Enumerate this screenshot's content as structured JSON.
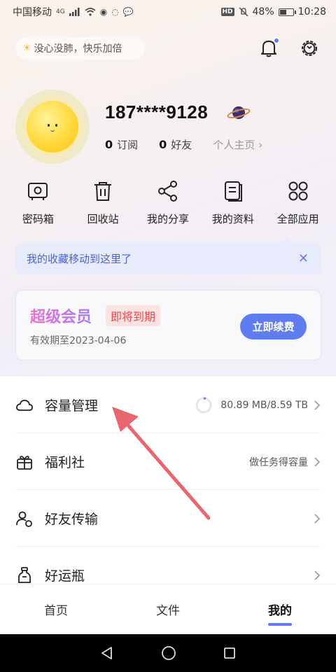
{
  "status_bar": {
    "carrier": "中国移动",
    "network": "4G",
    "battery": "48%",
    "time": "10:28",
    "hd": "HD"
  },
  "header": {
    "mood": "没心没肺，快乐加倍",
    "mood_icon": "☀"
  },
  "profile": {
    "phone": "187****9128",
    "subscribe_count": "0",
    "subscribe_label": "订阅",
    "friends_count": "0",
    "friends_label": "好友",
    "homepage_label": "个人主页 ›"
  },
  "grid": {
    "items": [
      {
        "label": "密码箱",
        "icon": "safe-icon"
      },
      {
        "label": "回收站",
        "icon": "trash-icon"
      },
      {
        "label": "我的分享",
        "icon": "share-icon"
      },
      {
        "label": "我的资料",
        "icon": "document-icon"
      },
      {
        "label": "全部应用",
        "icon": "apps-icon"
      }
    ]
  },
  "tip": {
    "text": "我的收藏移动到这里了",
    "close": "✕"
  },
  "vip": {
    "title": "超级会员",
    "tag": "即将到期",
    "expiry": "有效期至2023-04-06",
    "renew_label": "立即续费"
  },
  "list": {
    "items": [
      {
        "label": "容量管理",
        "value": "80.89 MB/8.59 TB",
        "icon": "cloud-icon"
      },
      {
        "label": "福利社",
        "value": "做任务得容量",
        "icon": "gift-icon"
      },
      {
        "label": "好友传输",
        "value": "",
        "icon": "friend-transfer-icon"
      },
      {
        "label": "好运瓶",
        "value": "",
        "icon": "bottle-icon"
      }
    ]
  },
  "tabs": [
    {
      "label": "首页"
    },
    {
      "label": "文件"
    },
    {
      "label": "我的",
      "active": true
    }
  ],
  "colors": {
    "accent": "#5f7df1",
    "tag_red": "#e7474a",
    "arrow": "#e8666e"
  }
}
